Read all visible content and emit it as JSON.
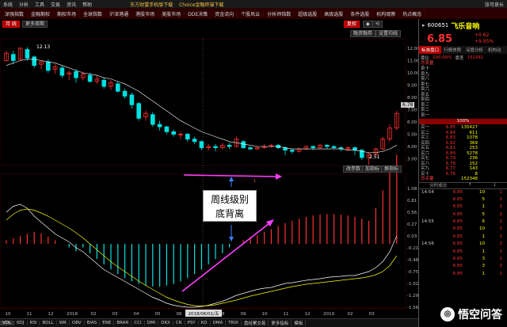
{
  "menubar": {
    "items": [
      "系统",
      "分析",
      "工具",
      "交易",
      "资讯",
      "帮助"
    ],
    "promo1": "东方财富手机版下载",
    "promo2": "Choice金融终端下载",
    "user": "张可泉长"
  },
  "catbar": [
    "深强指数",
    "金融期权",
    "期权市场",
    "全球指数",
    "沪深港通",
    "港股市场",
    "美股市场",
    "DDE决策",
    "资金流向",
    "个股风云",
    "分析师指数",
    "超级选股",
    "高级选股",
    "条件选股",
    "机构观察",
    "热点概念"
  ],
  "chart_toolbar": {
    "period": "月 线",
    "more_periods": "更多周期",
    "restore": "复权",
    "margin": "融资融券",
    "settings": "设置均线"
  },
  "kline": {
    "label_high": "12.13",
    "label_low": "2.51",
    "price_axis": [
      "12.00",
      "11.00",
      "10.00",
      "9.00",
      "8.00",
      "7.00",
      "6.00",
      "5.00",
      "4.00",
      "3.00"
    ],
    "current_price_tag": "6.78"
  },
  "macd": {
    "buttons": [
      "改参数",
      "加指标",
      "换指标"
    ],
    "axis": [
      "1.08",
      "0.81",
      "0.56",
      "0.27",
      "0.03",
      "-0.21",
      "-0.48",
      "-0.75",
      "-1.02",
      "-1.29",
      "-1.56"
    ]
  },
  "annotation": {
    "line1": "周线级别",
    "line2": "底背离"
  },
  "time_axis": [
    "10",
    "11",
    "12",
    "2018",
    "02",
    "03",
    "04",
    "05",
    "06",
    "07",
    "08",
    "09",
    "10",
    "11",
    "12",
    "2019",
    "02",
    "03"
  ],
  "cursor_date": "2018/06/01/五",
  "indicators": [
    "VOL",
    "KDJ",
    "RSI",
    "BOLL",
    "WR",
    "OBV",
    "BIAS",
    "ENE",
    "BRAR",
    "CCI",
    "DMI",
    "DKX",
    "CR",
    "PSY",
    "KD",
    "DMA",
    "TRIX",
    "盘经累交易",
    "更多指标",
    "模板"
  ],
  "quote": {
    "code": "600651",
    "name": "飞乐音响",
    "price": "6.85",
    "change": "+0.62",
    "change_pct": "+9.95%",
    "tabs": [
      "标准盘口",
      "行情快照",
      "深度分析",
      "机构动"
    ],
    "ratio_label": "委比",
    "ratio_value": "100.00%",
    "diff_label": "委差",
    "diff_value": "152341",
    "sell_label": "总卖量",
    "sells": [
      "卖十",
      "卖九",
      "卖八",
      "卖七",
      "卖六",
      "卖五",
      "卖四",
      "卖三",
      "卖二",
      "卖一"
    ],
    "pct100": "100%",
    "buys": [
      {
        "n": "买一",
        "p": "6.85",
        "v": "135427"
      },
      {
        "n": "买二",
        "p": "6.84",
        "v": "611"
      },
      {
        "n": "买三",
        "p": "6.83",
        "v": "1078"
      },
      {
        "n": "买四",
        "p": "6.82",
        "v": "369"
      },
      {
        "n": "买五",
        "p": "6.81",
        "v": "253"
      },
      {
        "n": "买六",
        "p": "6.80",
        "v": "5278"
      },
      {
        "n": "买七",
        "p": "6.79",
        "v": "236"
      },
      {
        "n": "买八",
        "p": "6.78",
        "v": "152"
      },
      {
        "n": "买九",
        "p": "6.77",
        "v": "143"
      },
      {
        "n": "买十",
        "p": "6.76",
        "v": "8"
      }
    ],
    "buy_total_label": "总买量",
    "buy_total": "152348",
    "ticks_tabs": [
      "分时成交",
      "↑",
      "↓"
    ],
    "ticks": [
      {
        "t": "14:54",
        "p": "6.85",
        "v": "10",
        "s": "1"
      },
      {
        "t": "",
        "p": "6.85",
        "v": "5",
        "s": "1"
      },
      {
        "t": "",
        "p": "6.85",
        "v": "1",
        "s": "1"
      },
      {
        "t": "",
        "p": "6.85",
        "v": "5",
        "s": "2"
      },
      {
        "t": "14:55",
        "p": "6.85",
        "v": "6",
        "s": "2"
      },
      {
        "t": "",
        "p": "6.85",
        "v": "10",
        "s": "2"
      },
      {
        "t": "",
        "p": "6.85",
        "v": "1",
        "s": "1"
      },
      {
        "t": "14:56",
        "p": "6.85",
        "v": "10",
        "s": "2"
      },
      {
        "t": "",
        "p": "6.85",
        "v": "1",
        "s": "1"
      },
      {
        "t": "",
        "p": "6.85",
        "v": "3",
        "s": "1"
      },
      {
        "t": "",
        "p": "6.85",
        "v": "3",
        "s": "2"
      },
      {
        "t": "",
        "p": "6.85",
        "v": "1",
        "s": "1"
      }
    ]
  },
  "watermark": {
    "text": "悟空问答"
  },
  "colors": {
    "up": "#ff3030",
    "down": "#00e0e0",
    "ma": "#ffffff",
    "macd_dif": "#ffffff",
    "macd_dea": "#ffff00",
    "arrow": "#ff40ff",
    "marker": "#4080ff"
  }
}
